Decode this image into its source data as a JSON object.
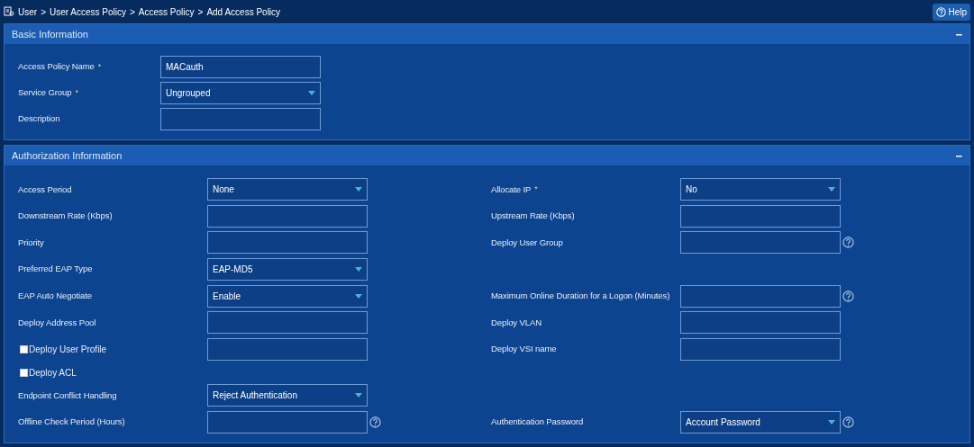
{
  "breadcrumb": [
    "User",
    "User Access Policy",
    "Access Policy",
    "Add Access Policy"
  ],
  "breadcrumb_separator": ">",
  "help_button": {
    "label": "Help"
  },
  "basic": {
    "title": "Basic Information",
    "collapse": "−",
    "fields": [
      {
        "label": "Access Policy Name",
        "required_mark": "*",
        "kind": "text",
        "value": "MACauth"
      },
      {
        "label": "Service Group",
        "required_mark": "*",
        "kind": "select",
        "value": "Ungrouped"
      },
      {
        "label": "Description",
        "kind": "text"
      }
    ]
  },
  "authorization": {
    "title": "Authorization Information",
    "collapse": "−",
    "rows": [
      {
        "left": {
          "label": "Access Period",
          "kind": "select",
          "value": "None"
        },
        "right": {
          "label": "Allocate IP",
          "required_mark": "*",
          "kind": "select",
          "value": "No"
        }
      },
      {
        "left": {
          "label": "Downstream Rate (Kbps)",
          "kind": "text"
        },
        "right": {
          "label": "Upstream Rate (Kbps)",
          "kind": "text"
        }
      },
      {
        "left": {
          "label": "Priority",
          "kind": "text"
        },
        "right": {
          "label": "Deploy User Group",
          "kind": "text",
          "help": true
        }
      },
      {
        "left": {
          "label": "Preferred EAP Type",
          "kind": "select",
          "value": "EAP-MD5"
        }
      },
      {
        "left": {
          "label": "EAP Auto Negotiate",
          "kind": "select",
          "value": "Enable"
        },
        "right": {
          "label": "Maximum Online Duration for a Logon (Minutes)",
          "kind": "text",
          "help": true
        }
      },
      {
        "left": {
          "label": "Deploy Address Pool",
          "kind": "text"
        },
        "right": {
          "label": "Deploy VLAN",
          "kind": "text"
        }
      },
      {
        "left": {
          "label": "Deploy User Profile",
          "kind": "checkbox-text",
          "checked": false
        },
        "right": {
          "label": "Deploy VSI name",
          "kind": "text"
        }
      },
      {
        "left": {
          "label": "Deploy ACL",
          "kind": "checkbox",
          "checked": false
        }
      },
      {
        "left": {
          "label": "Endpoint Conflict Handling",
          "kind": "select",
          "value": "Reject Authentication"
        }
      },
      {
        "left": {
          "label": "Offline Check Period (Hours)",
          "kind": "text",
          "help": true
        },
        "right": {
          "label": "Authentication Password",
          "kind": "select",
          "value": "Account Password",
          "help": true
        }
      }
    ]
  }
}
